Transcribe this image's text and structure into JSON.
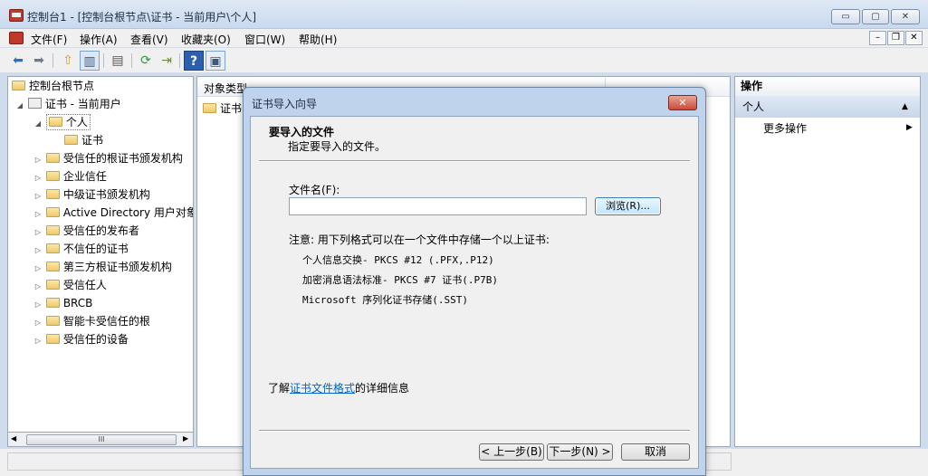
{
  "window": {
    "title": "控制台1 - [控制台根节点\\证书 - 当前用户\\个人]",
    "buttons": {
      "minimize": "▭",
      "maximize": "▢",
      "close": "✕"
    }
  },
  "menu": {
    "items": [
      "文件(F)",
      "操作(A)",
      "查看(V)",
      "收藏夹(O)",
      "窗口(W)",
      "帮助(H)"
    ],
    "mdi_buttons": {
      "minimize": "–",
      "restore": "❐",
      "close": "✕"
    }
  },
  "toolbar": {
    "icons": [
      "back-icon",
      "forward-icon",
      "up-icon",
      "show-tree-icon",
      "properties-icon",
      "refresh-icon",
      "export-icon",
      "help-icon",
      "console-icon"
    ]
  },
  "tree": {
    "root": "控制台根节点",
    "cert_store": "证书 - 当前用户",
    "personal": "个人",
    "personal_child": "证书",
    "items": [
      "受信任的根证书颁发机构",
      "企业信任",
      "中级证书颁发机构",
      "Active Directory 用户对象",
      "受信任的发布者",
      "不信任的证书",
      "第三方根证书颁发机构",
      "受信任人",
      "BRCB",
      "智能卡受信任的根",
      "受信任的设备"
    ],
    "hscroll_grip": "III"
  },
  "center": {
    "column_header": "对象类型",
    "rows": [
      "证书"
    ]
  },
  "actions": {
    "header": "操作",
    "section": "个人",
    "more": "更多操作"
  },
  "dialog": {
    "title": "证书导入向导",
    "close": "✕",
    "heading": "要导入的文件",
    "subheading": "指定要导入的文件。",
    "filename_label": "文件名(F):",
    "filename_value": "",
    "browse_label": "浏览(R)...",
    "note_intro": "注意: 用下列格式可以在一个文件中存储一个以上证书:",
    "formats": [
      "个人信息交换- PKCS #12 (.PFX,.P12)",
      "加密消息语法标准- PKCS #7 证书(.P7B)",
      "Microsoft 序列化证书存储(.SST)"
    ],
    "more_info_prefix": "了解",
    "more_info_link": "证书文件格式",
    "more_info_suffix": "的详细信息",
    "back_label": "< 上一步(B)",
    "next_label": "下一步(N) >",
    "cancel_label": "取消"
  }
}
